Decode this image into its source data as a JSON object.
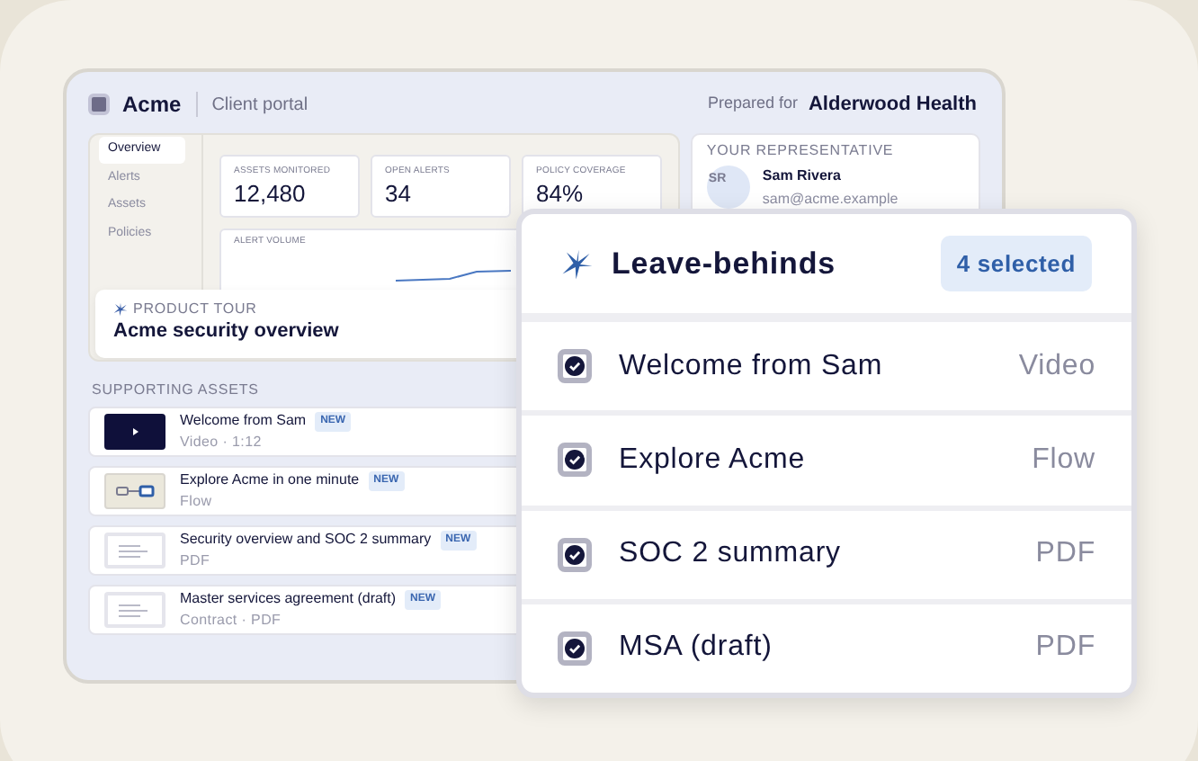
{
  "portal": {
    "brand": "Acme",
    "subtitle": "Client portal",
    "prepared_label": "Prepared for",
    "client": "Alderwood Health",
    "nav": [
      {
        "label": "Overview",
        "selected": true
      },
      {
        "label": "Alerts",
        "selected": false
      },
      {
        "label": "Assets",
        "selected": false
      },
      {
        "label": "Policies",
        "selected": false
      }
    ],
    "metrics": [
      {
        "label": "ASSETS MONITORED",
        "value": "12,480"
      },
      {
        "label": "OPEN ALERTS",
        "value": "34"
      },
      {
        "label": "POLICY COVERAGE",
        "value": "84%"
      }
    ],
    "chart_title": "ALERT VOLUME",
    "tour": {
      "label": "PRODUCT TOUR",
      "title": "Acme security overview"
    },
    "representative": {
      "heading": "YOUR REPRESENTATIVE",
      "initials": "SR",
      "name": "Sam Rivera",
      "email": "sam@acme.example"
    },
    "assets_heading": "SUPPORTING ASSETS",
    "assets": [
      {
        "kind": "video",
        "title": "Welcome from Sam",
        "badge": "NEW",
        "meta": "Video · 1:12"
      },
      {
        "kind": "flow",
        "title": "Explore Acme in one minute",
        "badge": "NEW",
        "meta": "Flow"
      },
      {
        "kind": "doc",
        "title": "Security overview and SOC 2 summary",
        "badge": "NEW",
        "meta": "PDF"
      },
      {
        "kind": "doc",
        "title": "Master services agreement (draft)",
        "badge": "NEW",
        "meta": "Contract · PDF"
      }
    ]
  },
  "leave_behinds": {
    "title": "Leave-behinds",
    "count": "4 selected",
    "items": [
      {
        "label": "Welcome from Sam",
        "type": "Video",
        "checked": true
      },
      {
        "label": "Explore Acme",
        "type": "Flow",
        "checked": true
      },
      {
        "label": "SOC 2 summary",
        "type": "PDF",
        "checked": true
      },
      {
        "label": "MSA (draft)",
        "type": "PDF",
        "checked": true
      }
    ]
  }
}
